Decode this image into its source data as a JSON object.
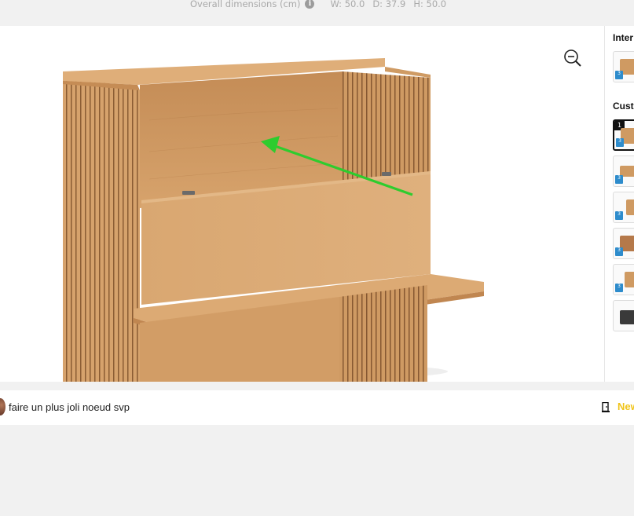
{
  "dimensions": {
    "label": "Overall dimensions (cm)",
    "info_icon": "info-icon",
    "width": "W: 50.0",
    "depth": "D: 37.9",
    "height": "H: 50.0"
  },
  "viewer": {
    "zoom_icon": "zoom-out-icon",
    "annotation": "green-arrow"
  },
  "right_panel": {
    "section_interior": "Inter",
    "section_custom": "Cust",
    "selected_index": "1",
    "badge_3d": "3"
  },
  "comment": {
    "text": "faire un plus joli noeud svp",
    "icon": "door-icon",
    "new_label": "New"
  },
  "colors": {
    "accent": "#f0c419",
    "arrow": "#2ecc2e",
    "wood": "#d4a06a"
  }
}
